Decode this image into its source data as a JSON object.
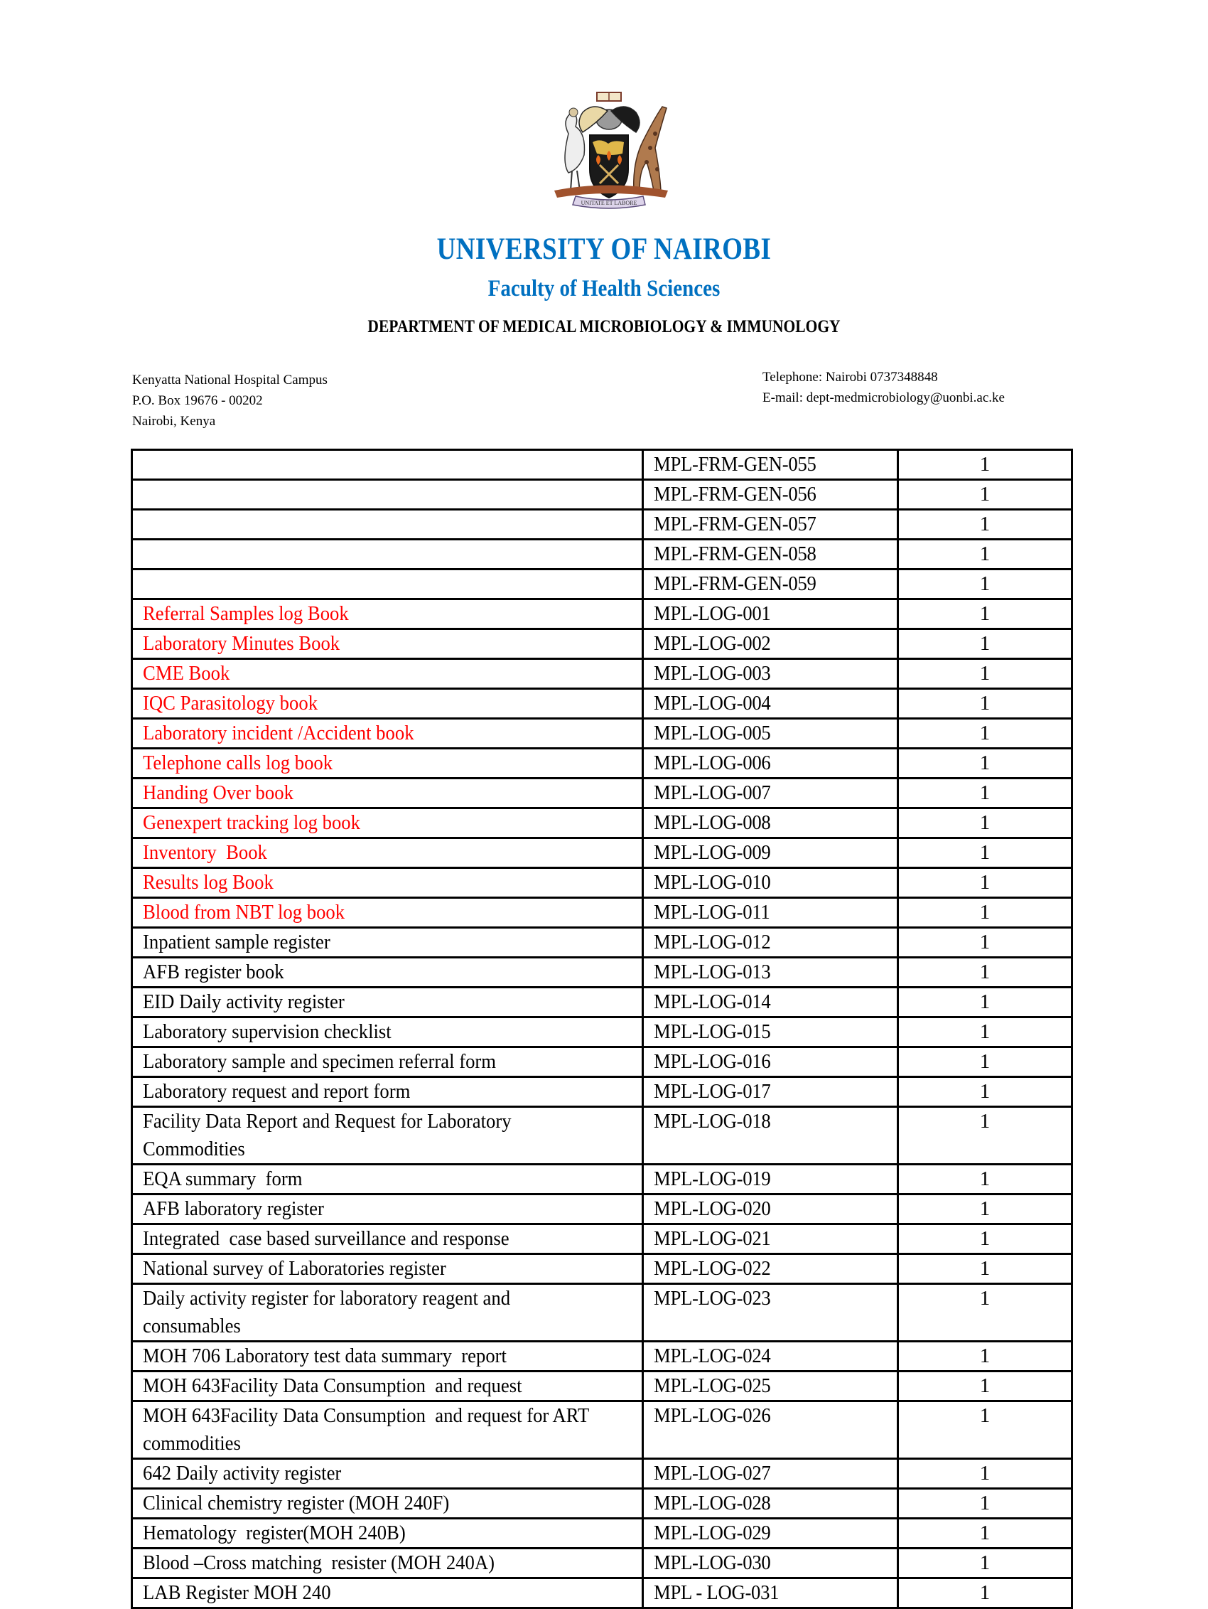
{
  "header": {
    "crest_icon": "university-coat-of-arms",
    "crest_motto": "UNITATE ET LABORE",
    "university": "UNIVERSITY  OF NAIROBI",
    "faculty": "Faculty of Health Sciences",
    "department": "DEPARTMENT  OF MEDICAL MICROBIOLOGY & IMMUNOLOGY",
    "brand_color": "#0070c0"
  },
  "address": {
    "line1": "Kenyatta National  Hospital Campus",
    "line2": "P.O.  Box  19676  - 00202",
    "line3": "Nairobi,  Kenya"
  },
  "contact": {
    "telephone": "Telephone: Nairobi  0737348848",
    "email": "E-mail:  dept-medmicrobiology@uonbi.ac.ke"
  },
  "table": {
    "highlight_color": "#ff0000",
    "rows": [
      {
        "name": "",
        "code": "MPL-FRM-GEN-055",
        "qty": "1",
        "highlight": false
      },
      {
        "name": "",
        "code": "MPL-FRM-GEN-056",
        "qty": "1",
        "highlight": false
      },
      {
        "name": "",
        "code": "MPL-FRM-GEN-057",
        "qty": "1",
        "highlight": false
      },
      {
        "name": "",
        "code": "MPL-FRM-GEN-058",
        "qty": "1",
        "highlight": false
      },
      {
        "name": "",
        "code": "MPL-FRM-GEN-059",
        "qty": "1",
        "highlight": false
      },
      {
        "name": "Referral Samples log Book",
        "code": "MPL-LOG-001",
        "qty": "1",
        "highlight": true
      },
      {
        "name": "Laboratory Minutes Book",
        "code": "MPL-LOG-002",
        "qty": "1",
        "highlight": true
      },
      {
        "name": "CME Book",
        "code": "MPL-LOG-003",
        "qty": "1",
        "highlight": true
      },
      {
        "name": "IQC Parasitology book",
        "code": "MPL-LOG-004",
        "qty": "1",
        "highlight": true
      },
      {
        "name": "Laboratory incident /Accident book",
        "code": "MPL-LOG-005",
        "qty": "1",
        "highlight": true
      },
      {
        "name": "Telephone calls log book",
        "code": "MPL-LOG-006",
        "qty": "1",
        "highlight": true
      },
      {
        "name": "Handing Over book",
        "code": "MPL-LOG-007",
        "qty": "1",
        "highlight": true
      },
      {
        "name": "Genexpert tracking log book",
        "code": "MPL-LOG-008",
        "qty": "1",
        "highlight": true
      },
      {
        "name": "Inventory  Book",
        "code": "MPL-LOG-009",
        "qty": "1",
        "highlight": true
      },
      {
        "name": "Results log Book",
        "code": "MPL-LOG-010",
        "qty": "1",
        "highlight": true
      },
      {
        "name": "Blood from NBT log book",
        "code": "MPL-LOG-011",
        "qty": "1",
        "highlight": true
      },
      {
        "name": "Inpatient sample register",
        "code": "MPL-LOG-012",
        "qty": "1",
        "highlight": false
      },
      {
        "name": "AFB register book",
        "code": "MPL-LOG-013",
        "qty": "1",
        "highlight": false
      },
      {
        "name": "EID Daily activity register",
        "code": "MPL-LOG-014",
        "qty": "1",
        "highlight": false
      },
      {
        "name": "Laboratory supervision checklist",
        "code": "MPL-LOG-015",
        "qty": "1",
        "highlight": false
      },
      {
        "name": "Laboratory sample and specimen referral form",
        "code": "MPL-LOG-016",
        "qty": "1",
        "highlight": false
      },
      {
        "name": "Laboratory request and report form",
        "code": "MPL-LOG-017",
        "qty": "1",
        "highlight": false
      },
      {
        "name": "Facility Data Report and Request for Laboratory Commodities",
        "code": "MPL-LOG-018",
        "qty": "1",
        "highlight": false
      },
      {
        "name": "EQA summary  form",
        "code": "MPL-LOG-019",
        "qty": "1",
        "highlight": false
      },
      {
        "name": "AFB laboratory register",
        "code": "MPL-LOG-020",
        "qty": "1",
        "highlight": false
      },
      {
        "name": "Integrated  case based surveillance and response",
        "code": "MPL-LOG-021",
        "qty": "1",
        "highlight": false
      },
      {
        "name": "National survey of Laboratories register",
        "code": "MPL-LOG-022",
        "qty": "1",
        "highlight": false
      },
      {
        "name": "Daily activity register for laboratory reagent and consumables",
        "code": "MPL-LOG-023",
        "qty": "1",
        "highlight": false
      },
      {
        "name": "MOH 706 Laboratory test data summary  report",
        "code": "MPL-LOG-024",
        "qty": "1",
        "highlight": false
      },
      {
        "name": "MOH 643Facility Data Consumption  and request",
        "code": "MPL-LOG-025",
        "qty": "1",
        "highlight": false
      },
      {
        "name": "MOH 643Facility Data Consumption  and request for ART commodities",
        "code": "MPL-LOG-026",
        "qty": "1",
        "highlight": false
      },
      {
        "name": "642 Daily activity register",
        "code": "MPL-LOG-027",
        "qty": "1",
        "highlight": false
      },
      {
        "name": "Clinical chemistry register (MOH 240F)",
        "code": "MPL-LOG-028",
        "qty": "1",
        "highlight": false
      },
      {
        "name": "Hematology  register(MOH 240B)",
        "code": "MPL-LOG-029",
        "qty": "1",
        "highlight": false
      },
      {
        "name": "Blood –Cross matching  resister (MOH 240A)",
        "code": "MPL-LOG-030",
        "qty": "1",
        "highlight": false
      },
      {
        "name": "LAB Register MOH 240",
        "code": "MPL - LOG-031",
        "qty": "1",
        "highlight": false
      }
    ]
  }
}
